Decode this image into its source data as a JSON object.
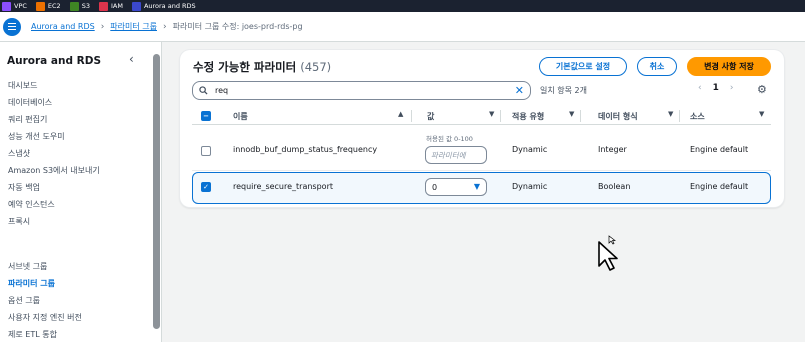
{
  "services": [
    {
      "label": "VPC",
      "color": "#8c4fff"
    },
    {
      "label": "EC2",
      "color": "#ed7100"
    },
    {
      "label": "S3",
      "color": "#3f8624"
    },
    {
      "label": "IAM",
      "color": "#dd344c"
    },
    {
      "label": "Aurora and RDS",
      "color": "#3b48cc"
    }
  ],
  "breadcrumb": {
    "root": "Aurora and RDS",
    "section": "파라미터 그룹",
    "current": "파라미터 그룹 수정: joes-prd-rds-pg"
  },
  "sidebar": {
    "title": "Aurora and RDS",
    "items": [
      {
        "label": "대시보드"
      },
      {
        "label": "데이터베이스"
      },
      {
        "label": "쿼리 편집기"
      },
      {
        "label": "성능 개선 도우미"
      },
      {
        "label": "스냅샷"
      },
      {
        "label": "Amazon S3에서 내보내기"
      },
      {
        "label": "자동 백업"
      },
      {
        "label": "예약 인스턴스"
      },
      {
        "label": "프록시"
      }
    ],
    "items2": [
      {
        "label": "서브넷 그룹"
      },
      {
        "label": "파라미터 그룹",
        "active": true
      },
      {
        "label": "옵션 그룹"
      },
      {
        "label": "사용자 지정 엔진 버전"
      },
      {
        "label": "제로 ETL 통합"
      }
    ]
  },
  "panel": {
    "title": "수정 가능한 파라미터",
    "count": "(457)",
    "buttons": {
      "reset_default": "기본값으로 설정",
      "cancel": "취소",
      "save": "변경 사항 저장"
    },
    "search": {
      "value": "req"
    },
    "match_text": "일치 항목 2개",
    "pagination": {
      "prev": "‹",
      "page": "1",
      "next": "›"
    },
    "columns": {
      "name": "이름",
      "value": "값",
      "apply_type": "적용 유형",
      "data_type": "데이터 형식",
      "source": "소스"
    },
    "rows": [
      {
        "name": "innodb_buf_dump_status_frequency",
        "value_hint": "허용된 값 0-100",
        "value_placeholder": "파라미터에",
        "apply_type": "Dynamic",
        "data_type": "Integer",
        "source": "Engine default",
        "selected": false
      },
      {
        "name": "require_secure_transport",
        "value": "0",
        "apply_type": "Dynamic",
        "data_type": "Boolean",
        "source": "Engine default",
        "selected": true
      }
    ]
  }
}
